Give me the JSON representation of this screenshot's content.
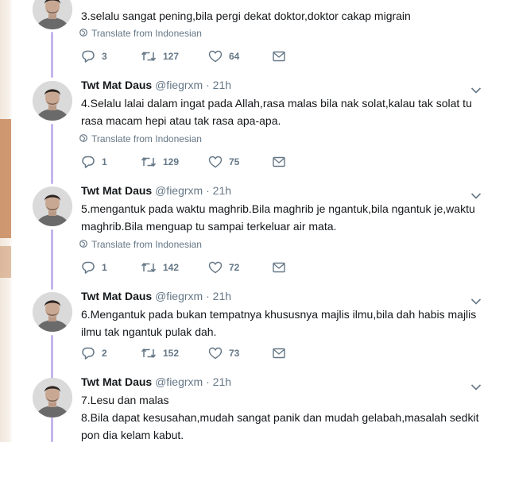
{
  "translate_label": "Translate from Indonesian",
  "tweets": [
    {
      "name": "",
      "handle": "",
      "time": "",
      "lines": [
        "3.selalu sangat pening,bila pergi dekat doktor,doktor cakap migrain"
      ],
      "replies": "3",
      "retweets": "127",
      "likes": "64"
    },
    {
      "name": "Twt Mat Daus",
      "handle": "@fiegrxm",
      "time": "21h",
      "lines": [
        "4.Selalu lalai dalam ingat pada Allah,rasa malas bila nak solat,kalau tak solat tu",
        "rasa macam hepi atau tak rasa apa-apa."
      ],
      "replies": "1",
      "retweets": "129",
      "likes": "75"
    },
    {
      "name": "Twt Mat Daus",
      "handle": "@fiegrxm",
      "time": "21h",
      "lines": [
        "5.mengantuk pada waktu maghrib.Bila maghrib je ngantuk,bila ngantuk je,waktu",
        "maghrib.Bila menguap tu sampai terkeluar air mata."
      ],
      "replies": "1",
      "retweets": "142",
      "likes": "72"
    },
    {
      "name": "Twt Mat Daus",
      "handle": "@fiegrxm",
      "time": "21h",
      "lines": [
        "6.Mengantuk pada bukan tempatnya khususnya majlis ilmu,bila dah habis majlis",
        "ilmu tak ngantuk pulak dah."
      ],
      "replies": "2",
      "retweets": "152",
      "likes": "73"
    },
    {
      "name": "Twt Mat Daus",
      "handle": "@fiegrxm",
      "time": "21h",
      "lines": [
        "7.Lesu dan malas",
        "8.Bila dapat kesusahan,mudah sangat panik dan mudah gelabah,masalah sedkit",
        "pon dia kelam kabut."
      ],
      "replies": "",
      "retweets": "",
      "likes": ""
    }
  ],
  "colors": {
    "thread_line": "#c4b5ee",
    "muted": "#657786",
    "text": "#14171a"
  }
}
